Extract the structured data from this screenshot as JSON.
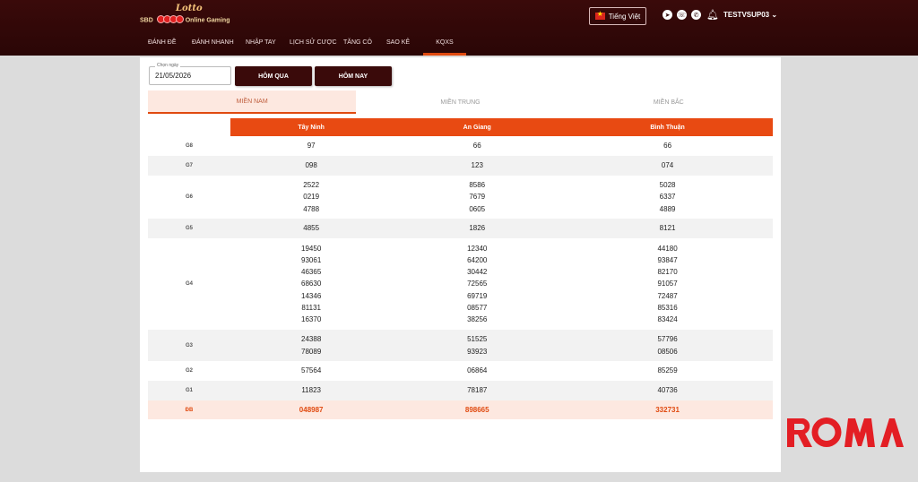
{
  "header": {
    "logo_title": "Lotto",
    "logo_left": "SBD",
    "logo_right": "Online Gaming",
    "language": "Tiếng Việt",
    "username": "TESTVSUP03",
    "icons": [
      "telegram-icon",
      "viber-icon",
      "whatsapp-icon",
      "bell-icon"
    ]
  },
  "nav": [
    "ĐÁNH ĐỀ",
    "ĐÁNH NHANH",
    "NHẬP TAY",
    "LỊCH SỬ CƯỢC",
    "TĂNG CÔ",
    "SAO KÊ",
    "KQXS"
  ],
  "controls": {
    "date_label": "Chọn ngày",
    "date_value": "21/05/2026",
    "yesterday": "HÔM QUA",
    "today": "HÔM NAY"
  },
  "tabs": [
    "MIỀN NAM",
    "MIỀN TRUNG",
    "MIỀN BẮC"
  ],
  "table": {
    "columns": [
      "Tây Ninh",
      "An Giang",
      "Bình Thuận"
    ],
    "rows": [
      {
        "label": "G8",
        "cells": [
          [
            "97"
          ],
          [
            "66"
          ],
          [
            "66"
          ]
        ]
      },
      {
        "label": "G7",
        "cells": [
          [
            "098"
          ],
          [
            "123"
          ],
          [
            "074"
          ]
        ]
      },
      {
        "label": "G6",
        "cells": [
          [
            "2522",
            "0219",
            "4788"
          ],
          [
            "8586",
            "7679",
            "0605"
          ],
          [
            "5028",
            "6337",
            "4889"
          ]
        ]
      },
      {
        "label": "G5",
        "cells": [
          [
            "4855"
          ],
          [
            "1826"
          ],
          [
            "8121"
          ]
        ]
      },
      {
        "label": "G4",
        "cells": [
          [
            "19450",
            "93061",
            "46365",
            "68630",
            "14346",
            "81131",
            "16370"
          ],
          [
            "12340",
            "64200",
            "30442",
            "72565",
            "69719",
            "08577",
            "38256"
          ],
          [
            "44180",
            "93847",
            "82170",
            "91057",
            "72487",
            "85316",
            "83424"
          ]
        ]
      },
      {
        "label": "G3",
        "cells": [
          [
            "24388",
            "78089"
          ],
          [
            "51525",
            "93923"
          ],
          [
            "57796",
            "08506"
          ]
        ]
      },
      {
        "label": "G2",
        "cells": [
          [
            "57564"
          ],
          [
            "06864"
          ],
          [
            "85259"
          ]
        ]
      },
      {
        "label": "G1",
        "cells": [
          [
            "11823"
          ],
          [
            "78187"
          ],
          [
            "40736"
          ]
        ]
      },
      {
        "label": "ĐB",
        "cells": [
          [
            "048987"
          ],
          [
            "898665"
          ],
          [
            "332731"
          ]
        ]
      }
    ]
  },
  "watermark": "ROMA",
  "colors": {
    "header_bg": "#2a0606",
    "accent": "#e84a12",
    "button_bg": "#3a0a0a",
    "db_row_bg": "#fde8e0"
  }
}
